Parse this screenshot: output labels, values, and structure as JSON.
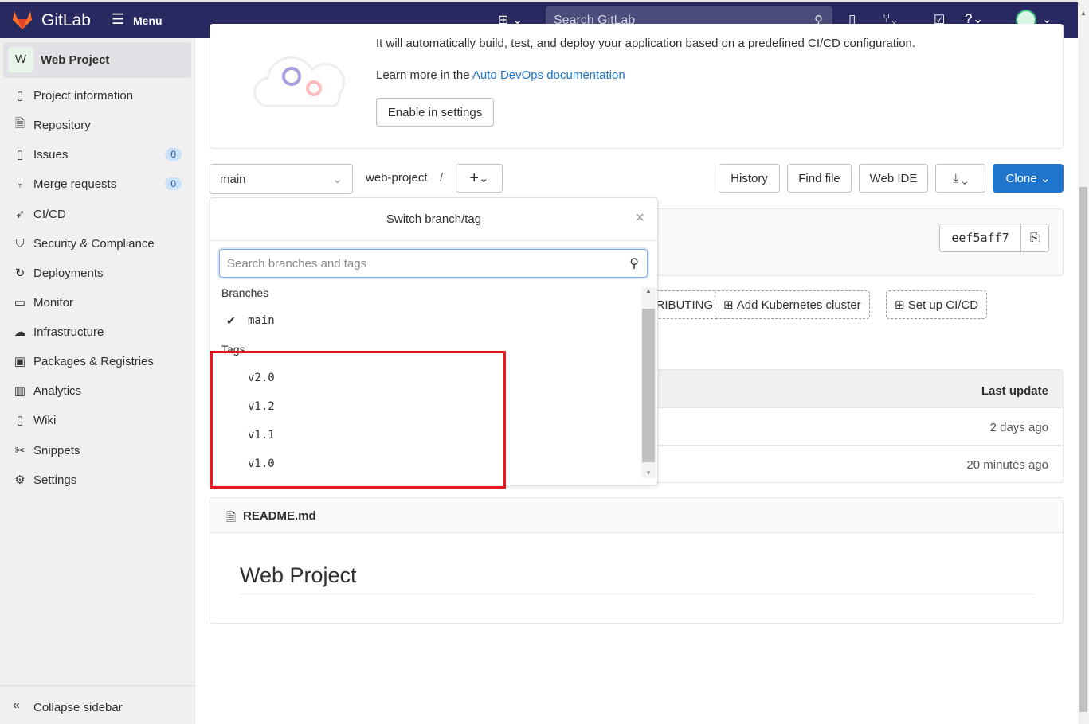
{
  "topbar": {
    "brand": "GitLab",
    "menu": "Menu",
    "search_placeholder": "Search GitLab"
  },
  "sidebar": {
    "project_initial": "W",
    "project_name": "Web Project",
    "items": [
      {
        "label": "Project information",
        "icon": "info-doc-icon"
      },
      {
        "label": "Repository",
        "icon": "document-icon"
      },
      {
        "label": "Issues",
        "icon": "issues-icon",
        "badge": "0"
      },
      {
        "label": "Merge requests",
        "icon": "merge-request-icon",
        "badge": "0"
      },
      {
        "label": "CI/CD",
        "icon": "rocket-icon"
      },
      {
        "label": "Security & Compliance",
        "icon": "shield-icon"
      },
      {
        "label": "Deployments",
        "icon": "deployments-icon"
      },
      {
        "label": "Monitor",
        "icon": "monitor-icon"
      },
      {
        "label": "Infrastructure",
        "icon": "cloud-gear-icon"
      },
      {
        "label": "Packages & Registries",
        "icon": "package-icon"
      },
      {
        "label": "Analytics",
        "icon": "chart-icon"
      },
      {
        "label": "Wiki",
        "icon": "book-icon"
      },
      {
        "label": "Snippets",
        "icon": "scissors-icon"
      },
      {
        "label": "Settings",
        "icon": "gear-icon"
      }
    ],
    "collapse": "Collapse sidebar"
  },
  "autodevops": {
    "text": "It will automatically build, test, and deploy your application based on a predefined CI/CD configuration.",
    "learn_prefix": "Learn more in the ",
    "learn_link": "Auto DevOps documentation",
    "enable": "Enable in settings"
  },
  "repo": {
    "branch": "main",
    "path": "web-project",
    "separator": "/",
    "history": "History",
    "find_file": "Find file",
    "web_ide": "Web IDE",
    "clone": "Clone",
    "commit_sha": "eef5aff7"
  },
  "actions": {
    "contributing": "CONTRIBUTING",
    "kubernetes": "Add Kubernetes cluster",
    "cicd": "Set up CI/CD"
  },
  "table": {
    "last_update": "Last update",
    "rows": [
      "2 days ago",
      "20 minutes ago"
    ]
  },
  "readme": {
    "filename": "README.md",
    "title": "Web Project"
  },
  "dropdown": {
    "title": "Switch branch/tag",
    "search_placeholder": "Search branches and tags",
    "branches_header": "Branches",
    "branches": [
      "main"
    ],
    "tags_header": "Tags",
    "tags": [
      "v2.0",
      "v1.2",
      "v1.1",
      "v1.0"
    ]
  },
  "colors": {
    "navbar": "#292961",
    "primary": "#1f75cb",
    "highlight": "#e8161f"
  }
}
